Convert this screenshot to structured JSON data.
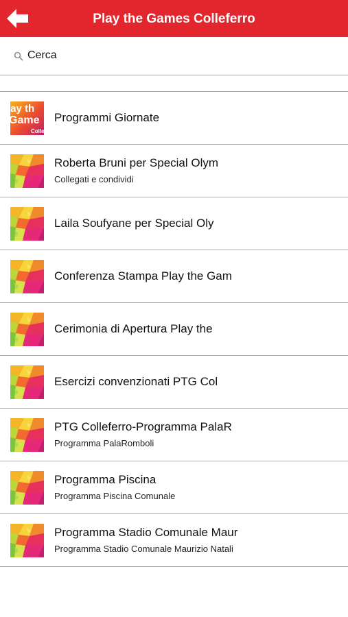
{
  "nav": {
    "title": "Play the Games Colleferro",
    "back_icon": "back-arrow-icon",
    "bar_color": "#e3262e"
  },
  "search": {
    "placeholder": "Cerca",
    "icon": "search-icon"
  },
  "items": [
    {
      "title": "Programmi Giornate",
      "subtitle": "",
      "thumb": "ptg-logo",
      "thumb_lines": [
        "lay th",
        "Game",
        "Colle"
      ]
    },
    {
      "title": "Roberta Bruni per Special Olym",
      "subtitle": "Collegati e condividi",
      "thumb": "colorful-polygon"
    },
    {
      "title": "Laila Soufyane per Special Oly",
      "subtitle": "",
      "thumb": "colorful-polygon"
    },
    {
      "title": "Conferenza Stampa Play the Gam",
      "subtitle": "",
      "thumb": "colorful-polygon"
    },
    {
      "title": "Cerimonia di Apertura Play the",
      "subtitle": "",
      "thumb": "colorful-polygon"
    },
    {
      "title": "Esercizi convenzionati PTG Col",
      "subtitle": "",
      "thumb": "colorful-polygon"
    },
    {
      "title": "PTG Colleferro-Programma PalaR",
      "subtitle": "Programma PalaRomboli",
      "thumb": "colorful-polygon"
    },
    {
      "title": "Programma Piscina",
      "subtitle": "Programma Piscina Comunale",
      "thumb": "colorful-polygon"
    },
    {
      "title": "Programma Stadio Comunale Maur",
      "subtitle": "Programma Stadio Comunale Maurizio Natali",
      "thumb": "colorful-polygon"
    }
  ]
}
